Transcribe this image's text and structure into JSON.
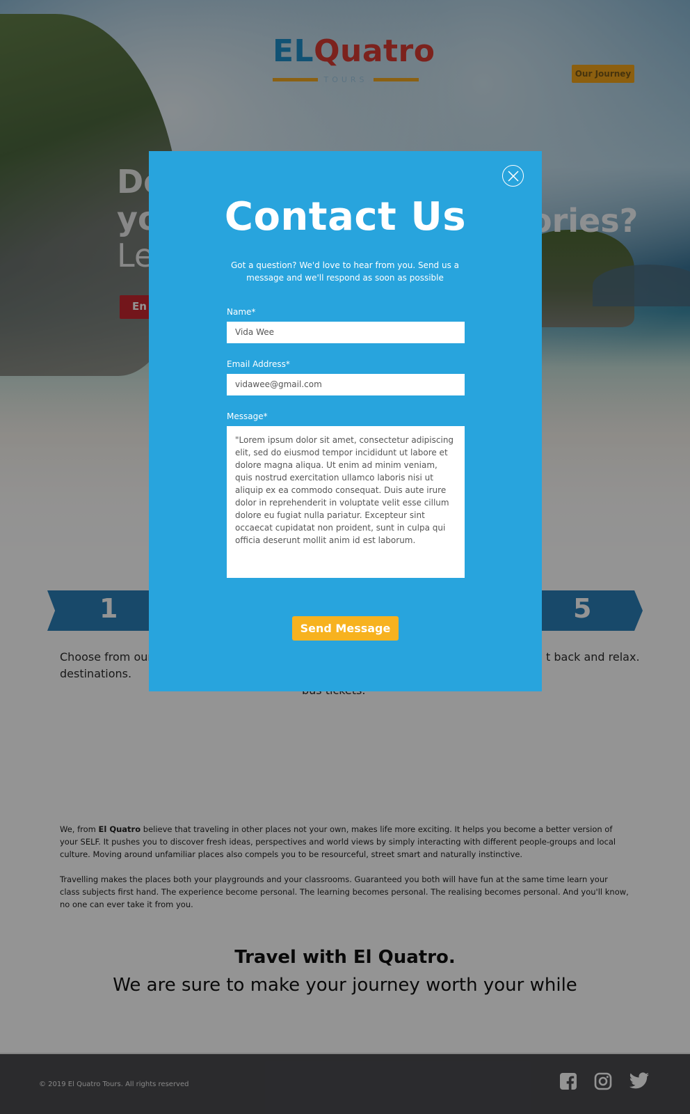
{
  "brand": {
    "logo_main_1": "EL",
    "logo_main_2": "Quatro",
    "logo_sub": "TOURS"
  },
  "nav": {
    "journey_label": "Our Journey"
  },
  "hero": {
    "headline_line1": "Do",
    "headline_line2": "yo",
    "headline_line3": "Le",
    "headline_right": "ories?",
    "cta_label": "En"
  },
  "steps": {
    "first_number": "1",
    "last_number": "5",
    "first_text_1": "Choose from our",
    "first_text_2": "destinations.",
    "middle_text": "bus tickets.",
    "last_text": "t back and relax."
  },
  "about": {
    "para1_prefix": "We, from ",
    "para1_brand": "El Quatro",
    "para1_rest": " believe that traveling in other places not your own, makes life more exciting. It helps you become a better version of your SELF. It pushes you to discover fresh ideas, perspectives and world views by simply interacting with different people-groups and local culture. Moving around unfamiliar places also compels you to be resourceful, street smart and naturally instinctive.",
    "para2": "Travelling makes the places both your playgrounds and your classrooms. Guaranteed you both will have fun at the same time learn your class subjects first hand. The experience become personal. The learning becomes personal. The realising becomes personal. And you'll know, no one can ever take it from you.",
    "tagline_1": "Travel with El Quatro.",
    "tagline_2": "We are sure to make your journey worth your while"
  },
  "footer": {
    "copyright": "© 2019 El Quatro Tours. All rights reserved",
    "icons": [
      "facebook-icon",
      "instagram-icon",
      "twitter-icon"
    ]
  },
  "modal": {
    "title": "Contact Us",
    "subtitle": "Got a question? We'd love to hear from you. Send us a message and  we'll respond as soon as possible",
    "name_label": "Name*",
    "name_value": "Vida Wee",
    "email_label": "Email Address*",
    "email_value": "vidawee@gmail.com",
    "message_label": "Message*",
    "message_value": "\"Lorem ipsum dolor sit amet, consectetur adipiscing elit, sed do eiusmod tempor incididunt ut labore et dolore magna aliqua. Ut enim ad minim veniam, quis nostrud exercitation ullamco laboris nisi ut aliquip ex ea commodo consequat. Duis aute irure dolor in reprehenderit in voluptate velit esse cillum dolore eu fugiat nulla pariatur. Excepteur sint occaecat cupidatat non proident, sunt in culpa qui officia deserunt mollit anim id est laborum.",
    "send_label": "Send Message"
  },
  "colors": {
    "modal_bg": "#28a4dd",
    "send_button": "#f7b21f",
    "footer_bg": "#4a4a4f",
    "accent_red": "#c6262f"
  }
}
